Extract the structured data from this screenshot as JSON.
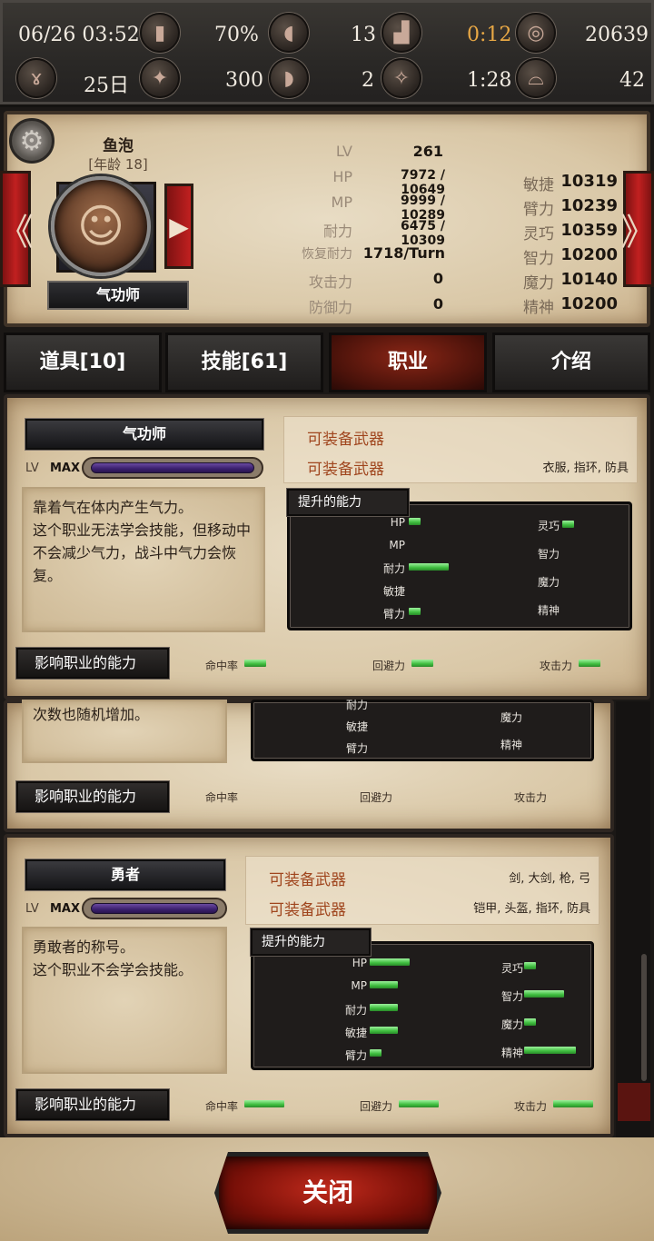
{
  "topbar": {
    "datetime": "06/26 03:52",
    "day": "25日",
    "battery": "70%",
    "meat_count": "13",
    "boot_count": "13",
    "boot_lower": "2",
    "timer_top": "0:12",
    "timer_bottom": "1:28",
    "coins": "20639",
    "pot": "42",
    "icon_count_300": "300"
  },
  "character": {
    "name": "鱼泡",
    "age": "[年龄 18]",
    "job": "气功师",
    "lv_label": "LV",
    "lv": "261",
    "hp_label": "HP",
    "hp": "7972 / 10649",
    "mp_label": "MP",
    "mp": "9999 / 10289",
    "stamina_label": "耐力",
    "stamina": "6475 / 10309",
    "regen_label": "恢复耐力",
    "regen": "1718/Turn",
    "atk_label": "攻击力",
    "atk": "0",
    "def_label": "防御力",
    "def": "0",
    "agi_label": "敏捷",
    "agi": "10319",
    "str_label": "臂力",
    "str": "10239",
    "dex_label": "灵巧",
    "dex": "10359",
    "int_label": "智力",
    "int": "10200",
    "mag_label": "魔力",
    "mag": "10140",
    "spi_label": "精神",
    "spi": "10200"
  },
  "tabs": [
    "道具[10]",
    "技能[61]",
    "职业",
    "介绍"
  ],
  "common": {
    "lv": "LV",
    "max": "MAX",
    "equip_weapon": "可装备武器",
    "boost_title": "提升的能力",
    "affect_title": "影响职业的能力",
    "hit": "命中率",
    "evade": "回避力",
    "attack": "攻击力",
    "hp": "HP",
    "mp": "MP",
    "stamina": "耐力",
    "agi": "敏捷",
    "str": "臂力",
    "dex": "灵巧",
    "int": "智力",
    "mag": "魔力",
    "spi": "精神"
  },
  "jobs": [
    {
      "name": "气功师",
      "desc": "靠着气在体内产生气力。\n这个职业无法学会技能，但移动中不会减少气力，战斗中气力会恢复。",
      "equip1": "",
      "equip2": "衣服, 指环, 防具",
      "boost": {
        "hp": 0.3,
        "mp": 0,
        "stamina": 1.0,
        "agi": 0,
        "str": 0.3,
        "dex": 0.3,
        "int": 0,
        "mag": 0,
        "spi": 0
      },
      "affect": {
        "hit": 0.55,
        "evade": 0.55,
        "attack": 0.55
      }
    },
    {
      "partial_desc": "次数也随机增加。"
    },
    {
      "name": "勇者",
      "desc": "勇敢者的称号。\n这个职业不会学会技能。",
      "equip1": "剑, 大剑, 枪, 弓",
      "equip2": "铠甲, 头盔, 指环, 防具",
      "boost": {
        "hp": 1.0,
        "mp": 0.7,
        "stamina": 0.7,
        "agi": 0.7,
        "str": 0.3,
        "dex": 0.3,
        "int": 1.0,
        "mag": 0.3,
        "spi": 1.3
      },
      "affect": {
        "hit": 1.0,
        "evade": 1.0,
        "attack": 1.0
      }
    }
  ],
  "close_label": "关闭"
}
